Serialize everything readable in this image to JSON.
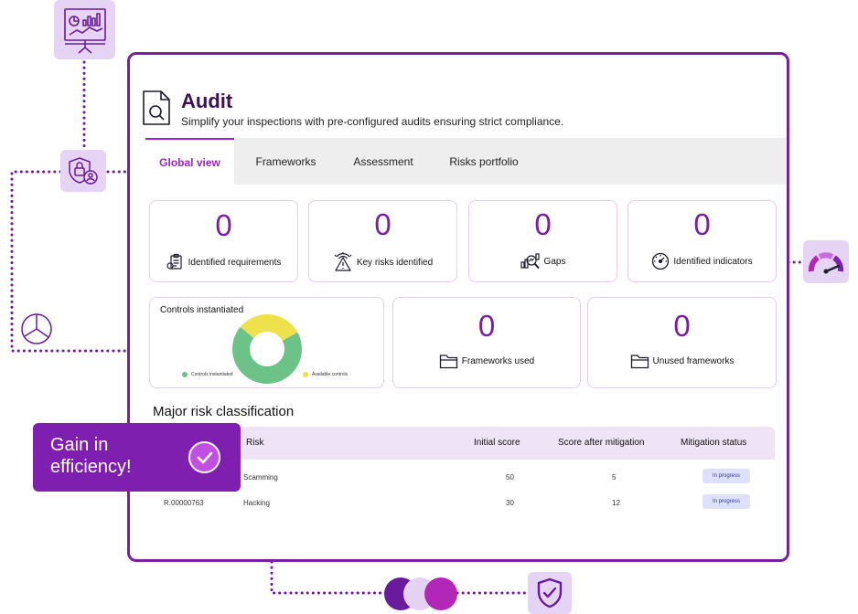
{
  "app": {
    "title": "Audit",
    "subtitle": "Simplify your inspections with pre-configured audits ensuring strict compliance."
  },
  "tabs": [
    {
      "label": "Global view",
      "active": true
    },
    {
      "label": "Frameworks",
      "active": false
    },
    {
      "label": "Assessment",
      "active": false
    },
    {
      "label": "Risks portfolio",
      "active": false
    }
  ],
  "stats": {
    "identified_requirements": {
      "value": "0",
      "label": "Identified requirements",
      "icon": "requirements-icon"
    },
    "key_risks": {
      "value": "0",
      "label": "Key risks identified",
      "icon": "risk-alert-icon"
    },
    "gaps": {
      "value": "0",
      "label": "Gaps",
      "icon": "gaps-analysis-icon"
    },
    "identified_indicators": {
      "value": "0",
      "label": "Identified indicators",
      "icon": "gauge-icon"
    },
    "frameworks_used": {
      "value": "0",
      "label": "Frameworks used",
      "icon": "folder-icon"
    },
    "unused_frameworks": {
      "value": "0",
      "label": "Unused frameworks",
      "icon": "folder-icon"
    }
  },
  "controls": {
    "title": "Controls instantiated",
    "legend": [
      {
        "label": "Controls instantiated",
        "color": "#6cc287"
      },
      {
        "label": "Available controls",
        "color": "#ede24c"
      }
    ]
  },
  "chart_data": {
    "type": "pie",
    "title": "Controls instantiated",
    "categories": [
      "Controls instantiated",
      "Available controls"
    ],
    "values": [
      69,
      31
    ],
    "colors": [
      "#6cc287",
      "#ede24c"
    ],
    "legend_position": "bottom"
  },
  "risk_section": {
    "title": "Major risk classification",
    "columns": [
      "Risk",
      "Initial score",
      "Score after mitigation",
      "Mitigation status"
    ],
    "rows": [
      {
        "id": "",
        "risk": "Scamming",
        "initial": "50",
        "after": "5",
        "status": "In progress"
      },
      {
        "id": "R.00000763",
        "risk": "Hacking",
        "initial": "30",
        "after": "12",
        "status": "In progress"
      }
    ]
  },
  "promo": {
    "line1": "Gain in",
    "line2": "efficiency!"
  },
  "colors": {
    "brand": "#7a1fa2",
    "accent": "#9b23c9",
    "tile": "#e6d4f4",
    "dots": [
      "#6a1a9a",
      "#e5d2f2",
      "#b227b8"
    ]
  },
  "decor_icons": [
    "presentation-chart-icon",
    "secure-user-icon",
    "pie-chart-icon",
    "speedometer-icon",
    "shield-check-icon"
  ]
}
